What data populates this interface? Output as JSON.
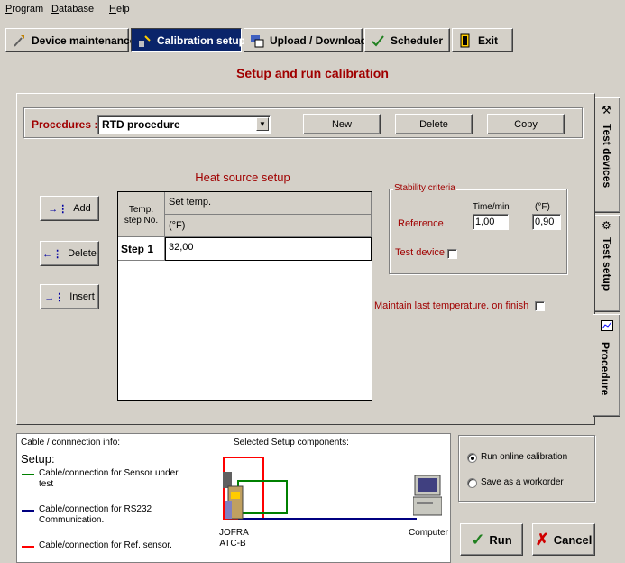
{
  "menu": {
    "items": [
      {
        "label": "Program",
        "underline": "P",
        "rest": "rogram"
      },
      {
        "label": "Database",
        "underline": "D",
        "rest": "atabase"
      },
      {
        "label": "Help",
        "underline": "H",
        "rest": "elp"
      }
    ]
  },
  "toolbar": {
    "device_maintenance": "Device maintenance",
    "calibration_setup": "Calibration setup",
    "upload_download": "Upload / Download",
    "scheduler": "Scheduler",
    "exit": "Exit"
  },
  "page_title": "Setup and run calibration",
  "procedures": {
    "label": "Procedures :",
    "selected": "RTD procedure",
    "new_label": "New",
    "delete_label": "Delete",
    "copy_label": "Copy"
  },
  "heat_source": {
    "title": "Heat source setup",
    "add_label": "Add",
    "delete_label": "Delete",
    "insert_label": "Insert",
    "col1_line1": "Temp.",
    "col1_line2": "step No.",
    "col2_line1": "Set temp.",
    "col2_line2": "(°F)",
    "rows": [
      {
        "step": "Step 1",
        "value": "32,00"
      }
    ]
  },
  "stability": {
    "title": "Stability criteria",
    "time_header": "Time/min",
    "unit_header": "(°F)",
    "reference_label": "Reference",
    "reference_time": "1,00",
    "reference_temp": "0,90",
    "test_device_label": "Test device",
    "test_device_checked": false
  },
  "maintain_last_label": "Maintain last temperature. on finish",
  "maintain_last_checked": false,
  "side_tabs": {
    "test_devices": "Test devices",
    "test_setup": "Test setup",
    "procedure": "Procedure"
  },
  "connection_info": {
    "title": "Cable / connnection info:",
    "setup_label": "Setup:",
    "legend": [
      {
        "color": "#008000",
        "text_line1": "Cable/connection for Sensor under",
        "text_line2": "test"
      },
      {
        "color": "#000080",
        "text_line1": "Cable/connection for RS232",
        "text_line2": "Communication."
      },
      {
        "color": "#ff0000",
        "text_line1": "Cable/connection for Ref. sensor.",
        "text_line2": ""
      }
    ],
    "selected_components_title": "Selected Setup components:",
    "device_line1": "JOFRA",
    "device_line2": "ATC-B",
    "computer_label": "Computer"
  },
  "run_options": {
    "online_label": "Run online calibration",
    "workorder_label": "Save as a workorder",
    "selected": "online"
  },
  "actions": {
    "run_label": "Run",
    "cancel_label": "Cancel"
  },
  "colors": {
    "title_red": "#a00000",
    "active_tab_bg": "#0a246a",
    "face": "#d4d0c8"
  }
}
